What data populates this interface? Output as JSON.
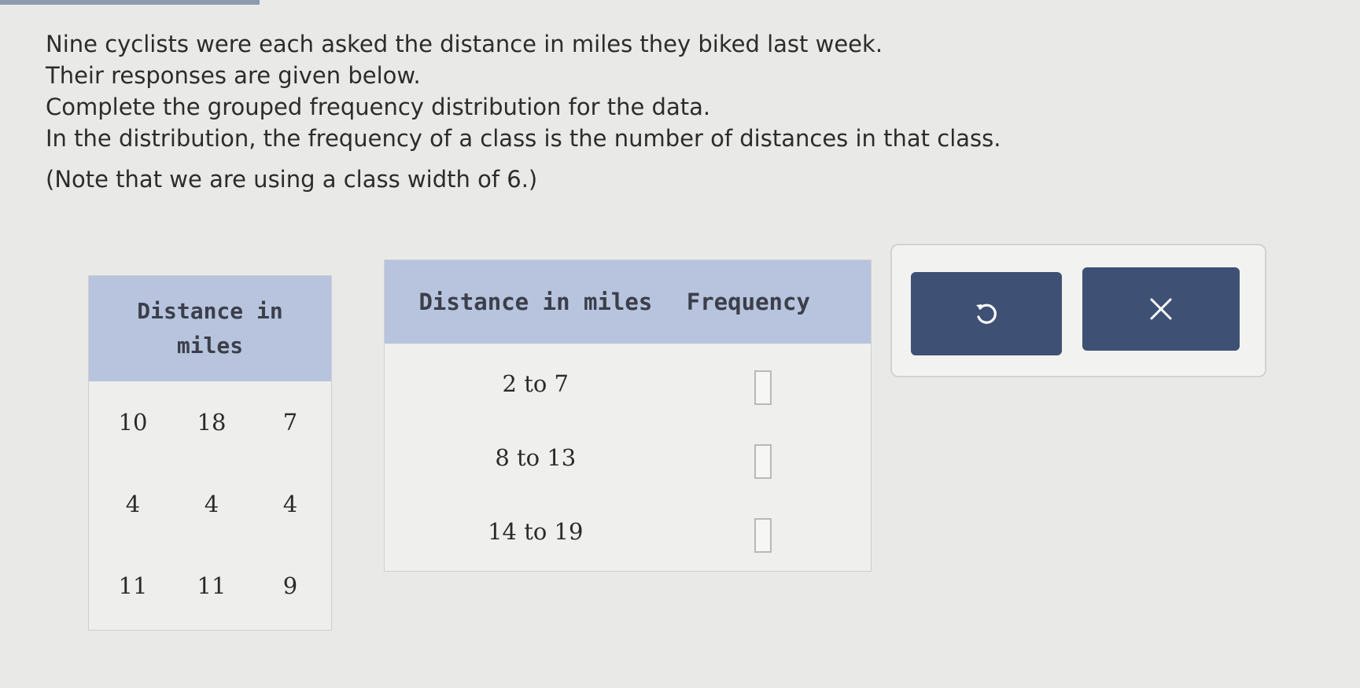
{
  "instructions": {
    "line1": "Nine cyclists were each asked the distance in miles they biked last week.",
    "line2": "Their responses are given below.",
    "line3": "Complete the grouped frequency distribution for the data.",
    "line4": "In the distribution, the frequency of a class is the number of distances in that class.",
    "note": "(Note that we are using a class width of 6.)"
  },
  "data_table": {
    "header_line1": "Distance in",
    "header_line2": "miles",
    "values": [
      "10",
      "18",
      "7",
      "4",
      "4",
      "4",
      "11",
      "11",
      "9"
    ]
  },
  "frequency_table": {
    "col_distance": "Distance in miles",
    "col_frequency": "Frequency",
    "rows": [
      {
        "range": "2 to 7",
        "frequency": ""
      },
      {
        "range": "8 to 13",
        "frequency": ""
      },
      {
        "range": "14 to 19",
        "frequency": ""
      }
    ]
  },
  "actions": {
    "undo_icon": "undo-icon",
    "clear_icon": "close-icon",
    "button_color": "#3e5175",
    "header_color": "#b8c4de"
  }
}
